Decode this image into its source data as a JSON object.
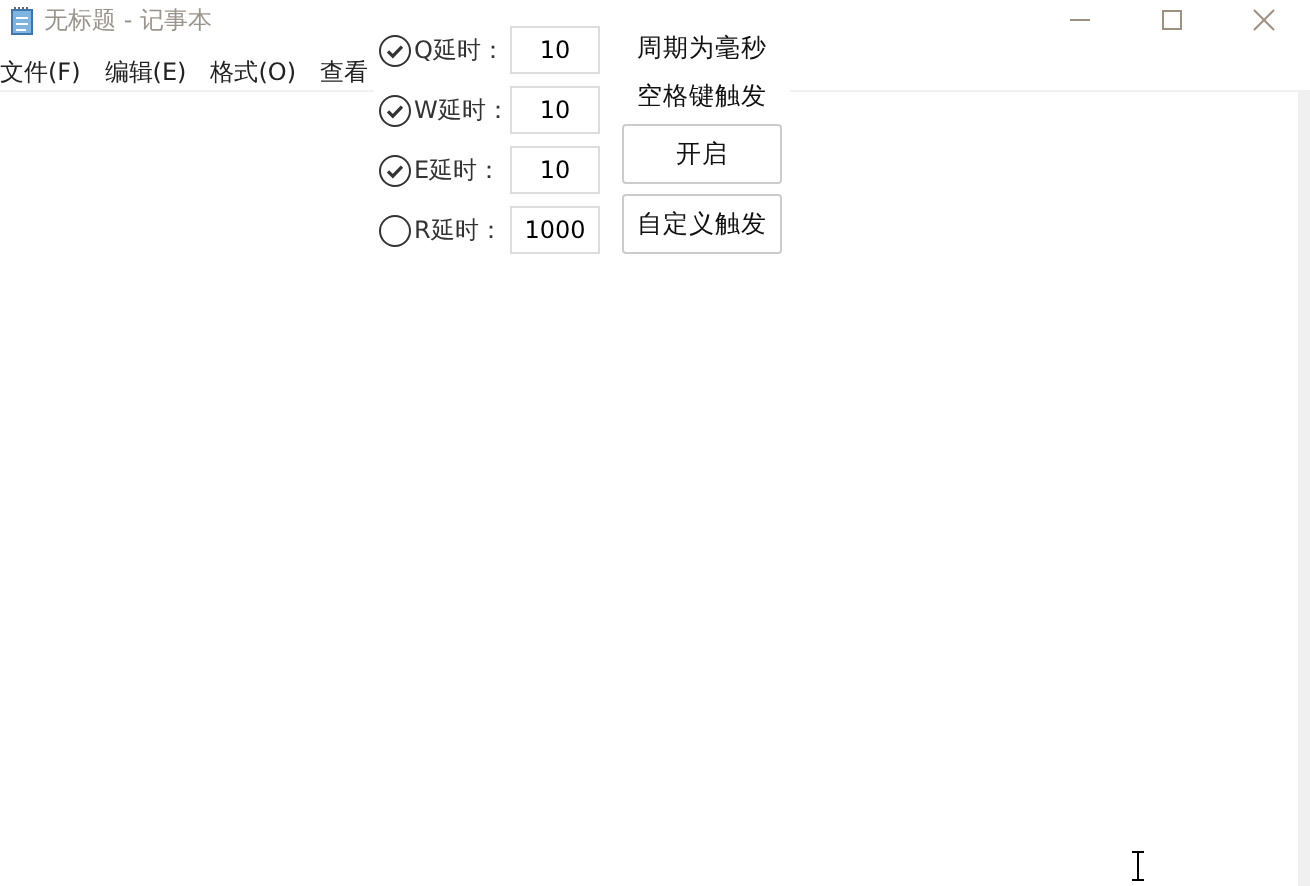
{
  "window": {
    "title": "无标题 - 记事本"
  },
  "menu": [
    "文件(F)",
    "编辑(E)",
    "格式(O)",
    "查看"
  ],
  "delays": [
    {
      "label": "Q延时：",
      "checked": true,
      "value": "10"
    },
    {
      "label": "W延时：",
      "checked": true,
      "value": "10"
    },
    {
      "label": "E延时：",
      "checked": true,
      "value": "10"
    },
    {
      "label": "R延时：",
      "checked": false,
      "value": "1000"
    }
  ],
  "notes": [
    "周期为毫秒",
    "空格键触发"
  ],
  "buttons": [
    "开启",
    "自定义触发"
  ]
}
